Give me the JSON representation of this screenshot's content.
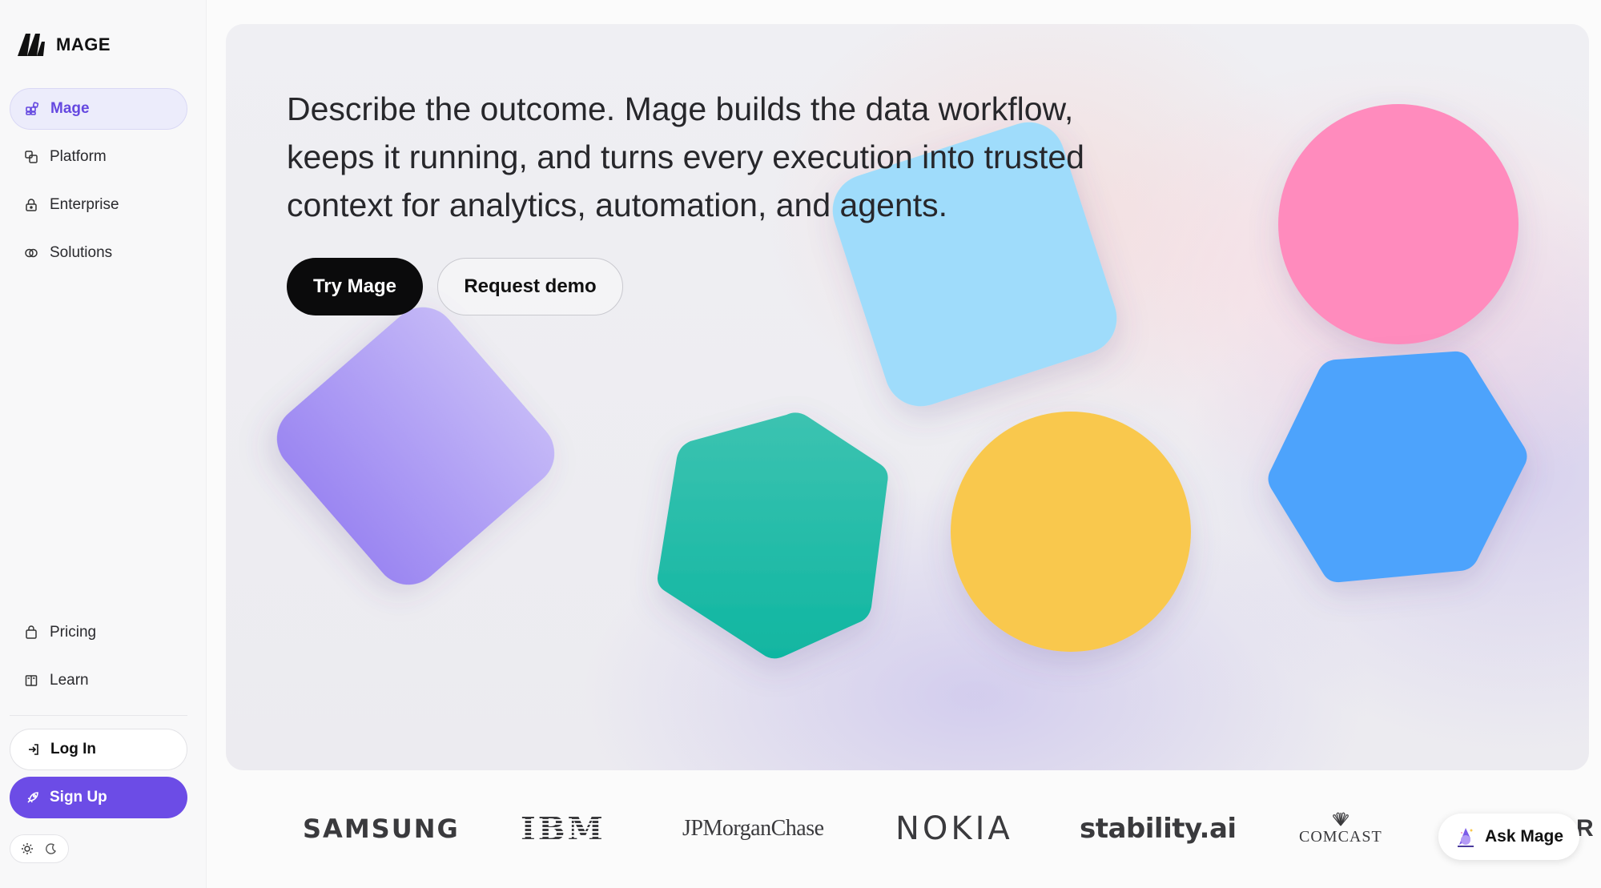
{
  "brand": {
    "name": "MAGE"
  },
  "sidebar": {
    "items": [
      {
        "label": "Mage",
        "icon": "grid-icon",
        "active": true
      },
      {
        "label": "Platform",
        "icon": "layers-icon"
      },
      {
        "label": "Enterprise",
        "icon": "lock-icon"
      },
      {
        "label": "Solutions",
        "icon": "link-rings-icon"
      }
    ],
    "bottom_items": [
      {
        "label": "Pricing",
        "icon": "tag-icon"
      },
      {
        "label": "Learn",
        "icon": "book-icon"
      }
    ],
    "login_label": "Log In",
    "signup_label": "Sign Up"
  },
  "hero": {
    "headline": "Describe the outcome. Mage builds the data workflow, keeps it running, and turns every execution into trusted context for analytics, automation, and agents.",
    "primary_cta": "Try Mage",
    "secondary_cta": "Request demo"
  },
  "client_logos": [
    "SAMSUNG",
    "IBM",
    "JPMorganChase",
    "NOKIA",
    "stability.ai",
    "COMCAST",
    "R"
  ],
  "assistant": {
    "label": "Ask Mage"
  },
  "colors": {
    "accent": "#6c4ce6",
    "shape_purple": "#a996f4",
    "shape_teal": "#14b8a6",
    "shape_sky": "#9fdcfb",
    "shape_yellow": "#f9c84e",
    "shape_pink": "#ff8bbd",
    "shape_blue": "#4ea3fc"
  }
}
